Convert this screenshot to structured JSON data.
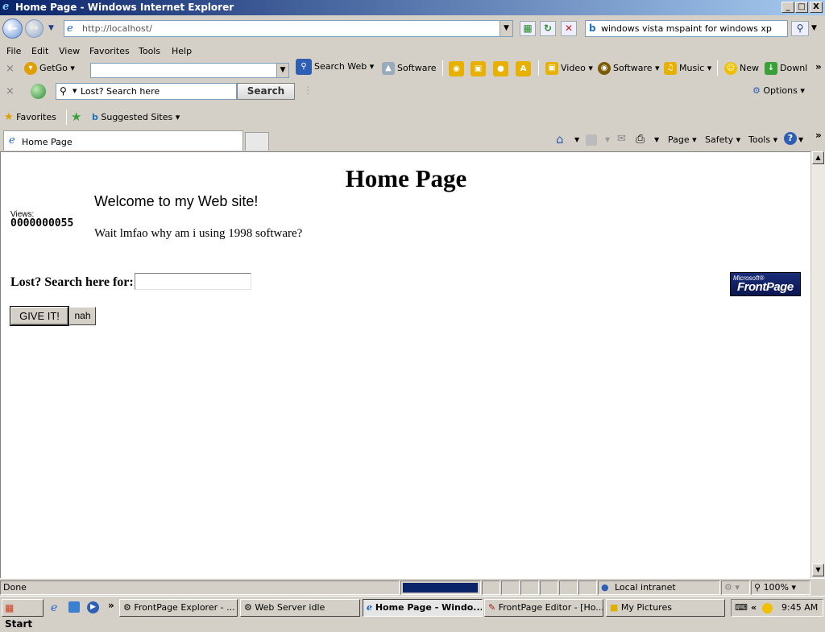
{
  "window": {
    "title": "Home Page - Windows Internet Explorer",
    "controls": {
      "minimize": "_",
      "maximize": "□",
      "close": "X"
    }
  },
  "address_bar": {
    "url": "http://localhost/"
  },
  "search_box": {
    "query": "windows vista mspaint for windows xp"
  },
  "menu": [
    "File",
    "Edit",
    "View",
    "Favorites",
    "Tools",
    "Help"
  ],
  "toolbar1": {
    "getgo": "GetGo",
    "search_web": "Search Web",
    "software": "Software",
    "video": "Video",
    "software2": "Software",
    "music": "Music",
    "new": "New",
    "download": "Downl"
  },
  "toolbar2": {
    "search_placeholder": "Lost? Search here",
    "search_button": "Search",
    "options": "Options"
  },
  "favorites_bar": {
    "favorites": "Favorites",
    "suggested_sites": "Suggested Sites"
  },
  "tabs": [
    {
      "label": "Home Page"
    }
  ],
  "command_bar": {
    "page": "Page",
    "safety": "Safety",
    "tools": "Tools"
  },
  "page": {
    "heading": "Home Page",
    "welcome": "Welcome to my Web site!",
    "views_label": "Views:",
    "views_count": "0000000055",
    "body_text": "Wait lmfao why am i using 1998 software?",
    "search_label": "Lost? Search here for:",
    "submit_label": "GIVE IT!",
    "reset_label": "nah",
    "logo_line1": "Microsoft®",
    "logo_line2": "FrontPage"
  },
  "status_bar": {
    "status": "Done",
    "zone": "Local intranet",
    "zoom": "100%"
  },
  "taskbar": {
    "start": "Start",
    "tasks": [
      {
        "label": "FrontPage Explorer - ..."
      },
      {
        "label": "Web Server idle"
      },
      {
        "label": "Home Page - Windo..."
      },
      {
        "label": "FrontPage Editor - [Ho..."
      },
      {
        "label": "My Pictures"
      }
    ],
    "clock": "9:45 AM"
  },
  "colors": {
    "title_gradient_start": "#0a246a",
    "chrome": "#d4d0c8",
    "link_blue": "#1d63c8"
  }
}
